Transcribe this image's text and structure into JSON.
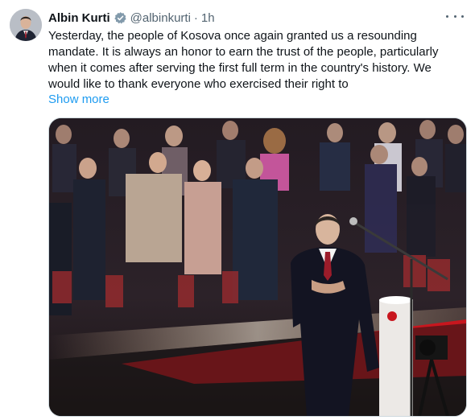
{
  "tweet": {
    "author_name": "Albin Kurti",
    "handle": "@albinkurti",
    "separator": "·",
    "time": "1h",
    "text_lines": [
      "Yesterday, the people of Kosova once again granted us a resounding",
      "mandate. It is always an honor to earn the trust of the people, particularly",
      "when it comes after serving the first full term in the country's history. We",
      "would like to thank everyone who exercised their right to"
    ],
    "show_more_label": "Show more"
  },
  "icons": {
    "verified": "verified-badge-icon",
    "more": "more-options-icon"
  },
  "colors": {
    "link": "#1d9bf0",
    "secondary_text": "#536471",
    "primary_text": "#0f1419",
    "stage_red": "#c8161e"
  }
}
